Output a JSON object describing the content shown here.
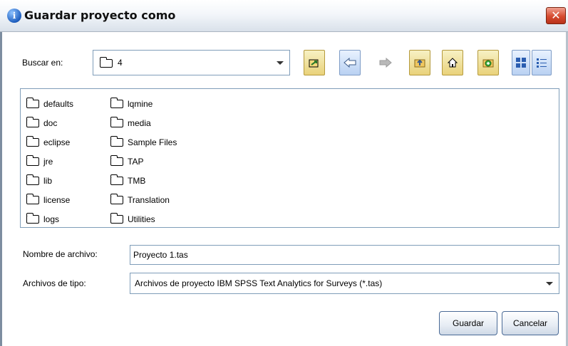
{
  "window": {
    "title": "Guardar proyecto como",
    "app_icon": "info-circle-icon",
    "close_label": "✕"
  },
  "lookin": {
    "label": "Buscar en:",
    "value": "4"
  },
  "toolbar": {
    "buttons": [
      "browse-icon",
      "back-arrow-icon",
      "forward-arrow-icon",
      "up-folder-icon",
      "home-icon",
      "new-folder-icon",
      "list-view-icon",
      "details-view-icon"
    ]
  },
  "files": {
    "column1": [
      "defaults",
      "doc",
      "eclipse",
      "jre",
      "lib",
      "license",
      "logs"
    ],
    "column2": [
      "lqmine",
      "media",
      "Sample Files",
      "TAP",
      "TMB",
      "Translation",
      "Utilities"
    ]
  },
  "filename": {
    "label": "Nombre de archivo:",
    "value": "Proyecto 1.tas"
  },
  "filetype": {
    "label": "Archivos de tipo:",
    "value": "Archivos de proyecto IBM SPSS Text Analytics for Surveys (*.tas)"
  },
  "buttons": {
    "save": "Guardar",
    "cancel": "Cancelar"
  },
  "colors": {
    "title_gradient_end": "#d9e1ea",
    "close_red": "#d64a2f",
    "border_blue": "#7f9db9"
  }
}
